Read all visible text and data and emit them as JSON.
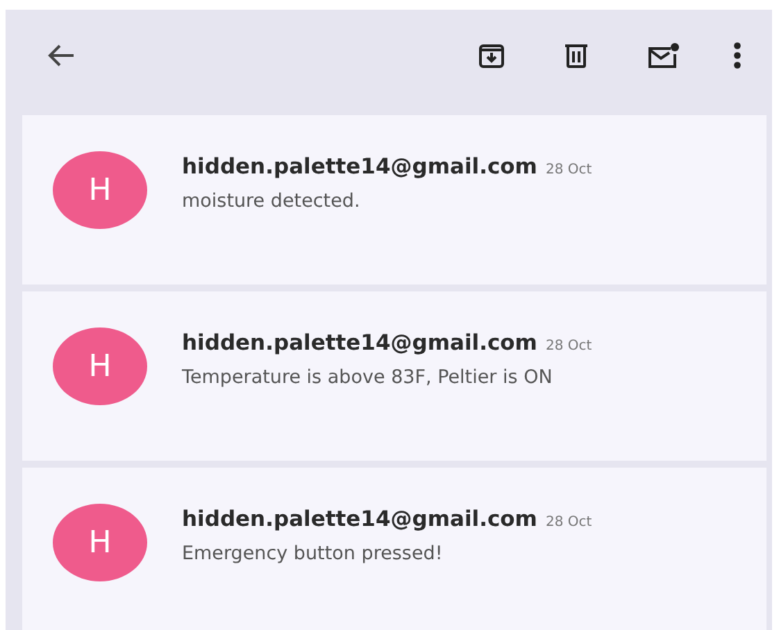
{
  "toolbar": {
    "actions": [
      {
        "kind": "archive"
      },
      {
        "kind": "delete"
      },
      {
        "kind": "unread"
      },
      {
        "kind": "more"
      }
    ]
  },
  "messages": [
    {
      "avatar": "H",
      "sender": "hidden.palette14@gmail.com",
      "date": "28 Oct",
      "snippet": "moisture detected."
    },
    {
      "avatar": "H",
      "sender": "hidden.palette14@gmail.com",
      "date": "28 Oct",
      "snippet": "Temperature is above 83F, Peltier is ON"
    },
    {
      "avatar": "H",
      "sender": "hidden.palette14@gmail.com",
      "date": "28 Oct",
      "snippet": "Emergency button pressed!"
    }
  ]
}
